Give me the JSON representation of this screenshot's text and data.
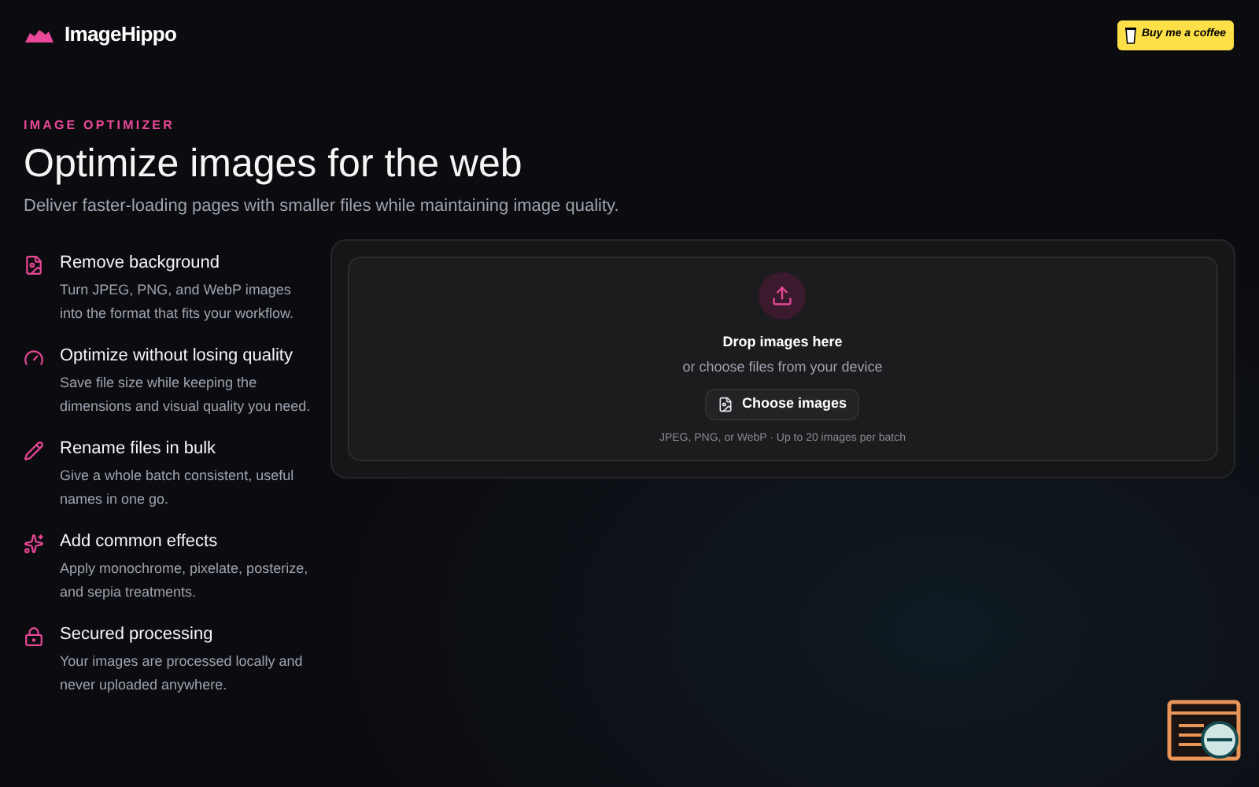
{
  "header": {
    "brand": "ImageHippo",
    "coffee_button": "Buy me a coffee"
  },
  "hero": {
    "eyebrow": "IMAGE OPTIMIZER",
    "title": "Optimize images for the web",
    "subtitle": "Deliver faster-loading pages with smaller files while maintaining image quality."
  },
  "features": [
    {
      "kind": "image",
      "title": "Remove background",
      "description": "Turn JPEG, PNG, and WebP images into the format that fits your workflow."
    },
    {
      "kind": "gauge",
      "title": "Optimize without losing quality",
      "description": "Save file size while keeping the dimensions and visual quality you need."
    },
    {
      "kind": "pencil",
      "title": "Rename files in bulk",
      "description": "Give a whole batch consistent, useful names in one go."
    },
    {
      "kind": "sparkles",
      "title": "Add common effects",
      "description": "Apply monochrome, pixelate, posterize, and sepia treatments."
    },
    {
      "kind": "lock",
      "title": "Secured processing",
      "description": "Your images are processed locally and never uploaded anywhere."
    }
  ],
  "dropzone": {
    "title": "Drop images here",
    "subtitle": "or choose files from your device",
    "button": "Choose images",
    "hint": "JPEG, PNG, or WebP · Up to 20 images per batch"
  }
}
